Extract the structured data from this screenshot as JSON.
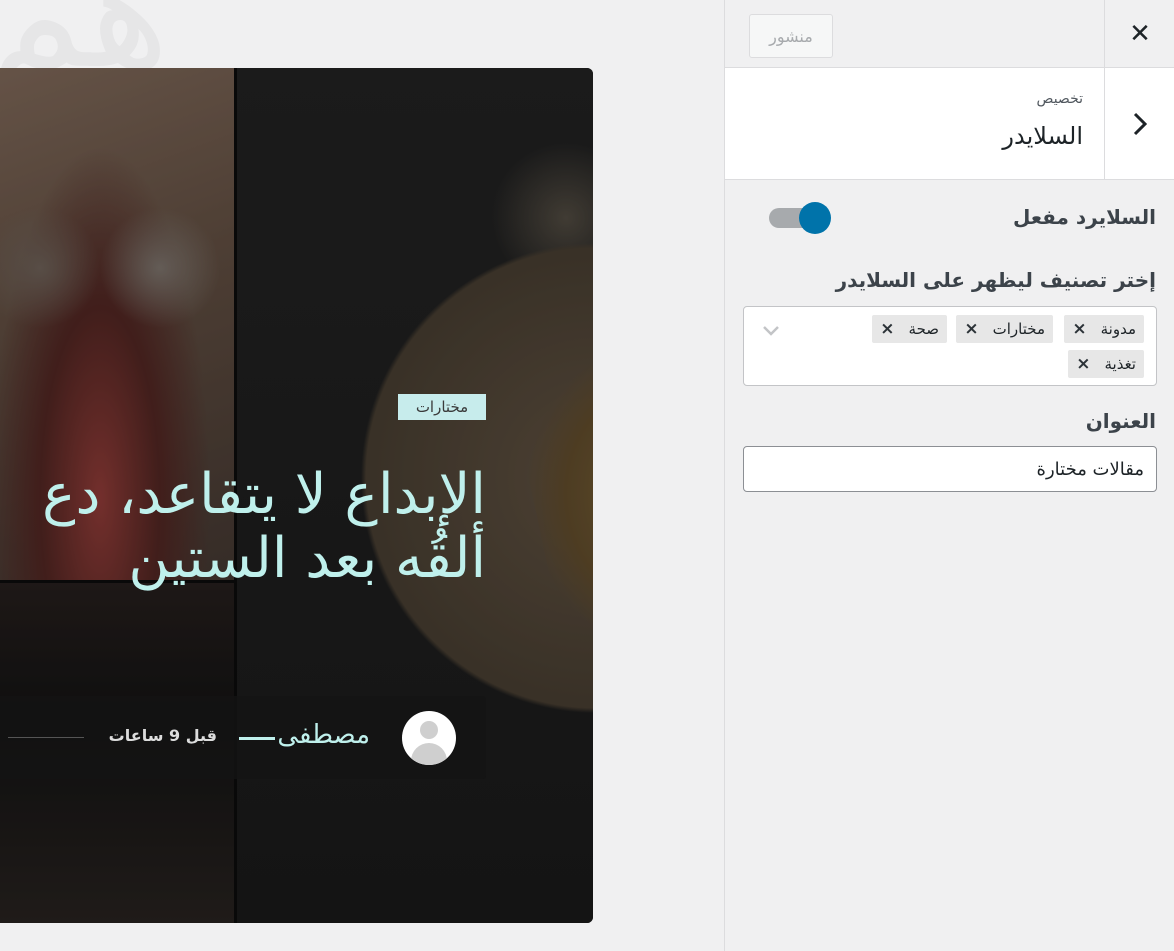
{
  "preview": {
    "category_badge": "مختارات",
    "title_line1": "الإبداع لا يتقاعد، دع",
    "title_line2": "ألقُه بعد الستين",
    "author": "مصطفى",
    "time_ago": "قبل 9 ساعات"
  },
  "panel": {
    "close_icon": "close-icon",
    "publish_label": "منشور",
    "breadcrumb": "تخصيص",
    "section_title": "السلايدر",
    "back_icon": "chevron-right-icon",
    "toggle_label": "السلايرد مفعل",
    "toggle_on": true,
    "accent_color": "#0073aa",
    "category_label": "إختر تصنيف ليظهر على السلايدر",
    "tags": [
      "مدونة",
      "مختارات",
      "صحة",
      "تغذية"
    ],
    "tag_remove_glyph": "×",
    "title_label": "العنوان",
    "title_value": "مقالات مختارة"
  }
}
